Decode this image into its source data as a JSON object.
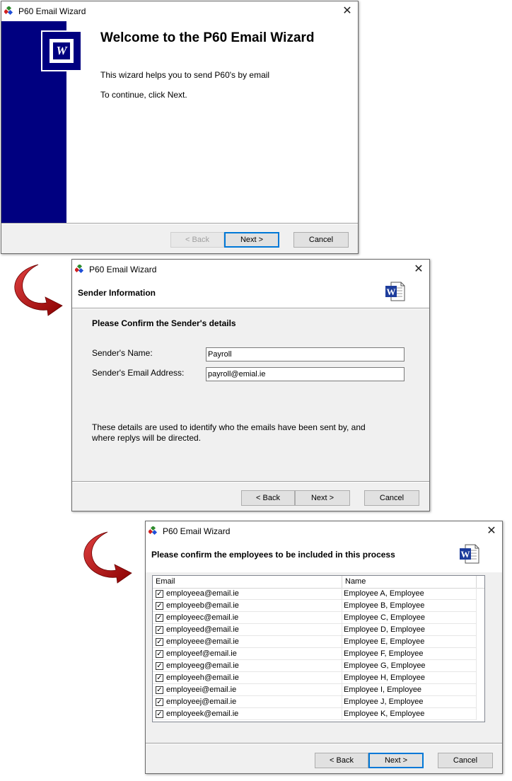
{
  "window1": {
    "title": "P60 Email Wizard",
    "heading": "Welcome to the P60 Email Wizard",
    "line1": "This wizard helps you to send P60's by email",
    "line2": "To continue, click Next.",
    "back": "< Back",
    "next": "Next >",
    "cancel": "Cancel",
    "sidebar_color": "#000080"
  },
  "window2": {
    "title": "P60 Email Wizard",
    "header": "Sender Information",
    "subheading": "Please Confirm the Sender's details",
    "name_label": "Sender's Name:",
    "name_value": "Payroll",
    "email_label": "Sender's Email Address:",
    "email_value": "payroll@emial.ie",
    "note": "These details are used to identify who the emails have been sent by, and where replys will be directed.",
    "back": "< Back",
    "next": "Next >",
    "cancel": "Cancel"
  },
  "window3": {
    "title": "P60 Email Wizard",
    "header": "Please confirm the employees to be included in this process",
    "columns": [
      "Email",
      "Name"
    ],
    "rows": [
      {
        "email": "employeea@email.ie",
        "name": "Employee A, Employee",
        "checked": true
      },
      {
        "email": "employeeb@email.ie",
        "name": "Employee B, Employee",
        "checked": true
      },
      {
        "email": "employeec@email.ie",
        "name": "Employee C, Employee",
        "checked": true
      },
      {
        "email": "employeed@email.ie",
        "name": "Employee D, Employee",
        "checked": true
      },
      {
        "email": "employeee@email.ie",
        "name": "Employee E, Employee",
        "checked": true
      },
      {
        "email": "employeef@email.ie",
        "name": "Employee F, Employee",
        "checked": true
      },
      {
        "email": "employeeg@email.ie",
        "name": "Employee G, Employee",
        "checked": true
      },
      {
        "email": "employeeh@email.ie",
        "name": "Employee H, Employee",
        "checked": true
      },
      {
        "email": "employeei@email.ie",
        "name": "Employee I, Employee",
        "checked": true
      },
      {
        "email": "employeej@email.ie",
        "name": "Employee J, Employee",
        "checked": true
      },
      {
        "email": "employeek@email.ie",
        "name": "Employee K, Employee",
        "checked": true
      }
    ],
    "back": "< Back",
    "next": "Next >",
    "cancel": "Cancel"
  },
  "icons": {
    "app": "wizard-app-icon",
    "word": "word-document-icon",
    "arrow": "red-curved-arrow-icon",
    "close": "close-icon"
  }
}
